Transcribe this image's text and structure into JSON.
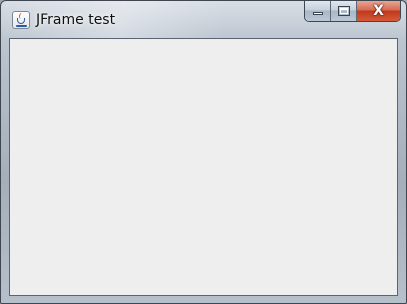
{
  "window": {
    "title": "JFrame test",
    "icon": "java-cup-icon",
    "controls": {
      "minimize_icon": "minimize-icon",
      "maximize_icon": "maximize-icon",
      "close_glyph": "X"
    }
  },
  "colors": {
    "client_background": "#eeeeee",
    "close_button": "#c7391e",
    "frame": "#aab5c1"
  }
}
